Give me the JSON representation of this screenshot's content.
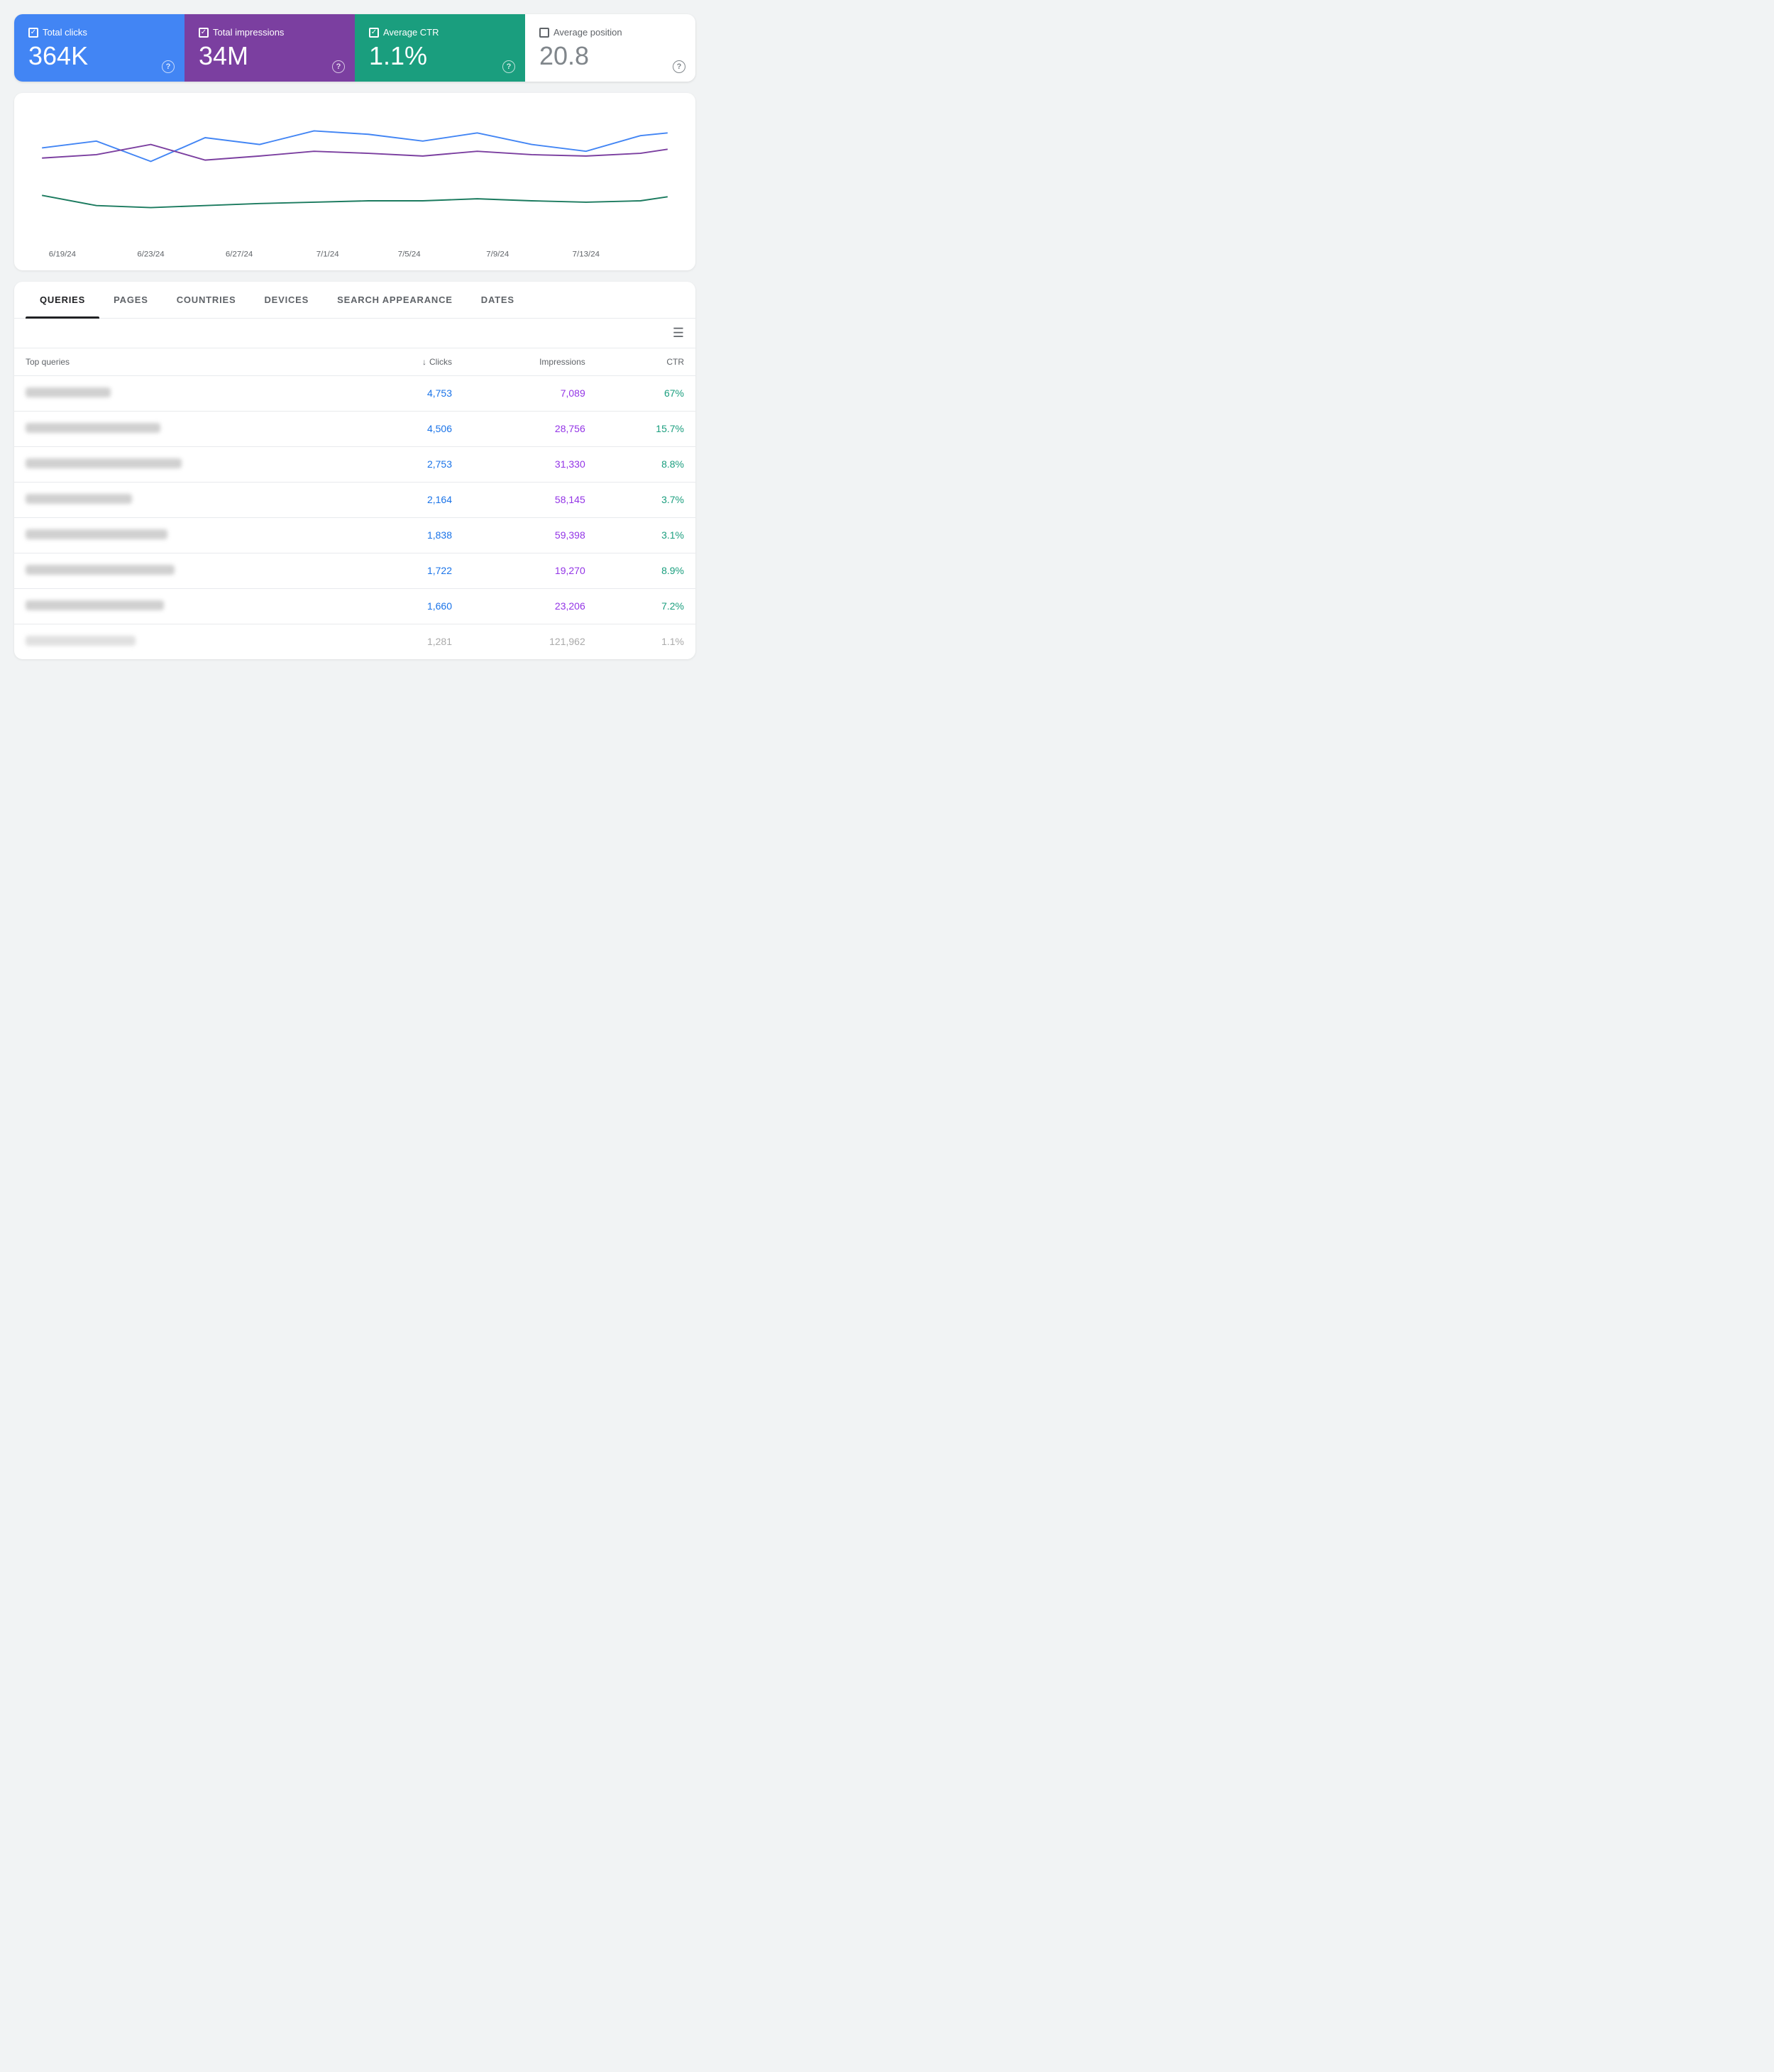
{
  "metrics": {
    "clicks": {
      "label": "Total clicks",
      "value": "364K",
      "checked": true,
      "help": "?"
    },
    "impressions": {
      "label": "Total impressions",
      "value": "34M",
      "checked": true,
      "help": "?"
    },
    "ctr": {
      "label": "Average CTR",
      "value": "1.1%",
      "checked": true,
      "help": "?"
    },
    "position": {
      "label": "Average position",
      "value": "20.8",
      "checked": false,
      "help": "?"
    }
  },
  "chart": {
    "dates": [
      "6/19/24",
      "6/23/24",
      "6/27/24",
      "7/1/24",
      "7/5/24",
      "7/9/24",
      "7/13/24"
    ]
  },
  "tabs": {
    "items": [
      {
        "label": "QUERIES",
        "active": true
      },
      {
        "label": "PAGES",
        "active": false
      },
      {
        "label": "COUNTRIES",
        "active": false
      },
      {
        "label": "DEVICES",
        "active": false
      },
      {
        "label": "SEARCH APPEARANCE",
        "active": false
      },
      {
        "label": "DATES",
        "active": false
      }
    ]
  },
  "table": {
    "header": {
      "query": "Top queries",
      "clicks": "Clicks",
      "impressions": "Impressions",
      "ctr": "CTR"
    },
    "rows": [
      {
        "query_width": 120,
        "clicks": "4,753",
        "impressions": "7,089",
        "ctr": "67%"
      },
      {
        "query_width": 190,
        "clicks": "4,506",
        "impressions": "28,756",
        "ctr": "15.7%"
      },
      {
        "query_width": 220,
        "clicks": "2,753",
        "impressions": "31,330",
        "ctr": "8.8%"
      },
      {
        "query_width": 150,
        "clicks": "2,164",
        "impressions": "58,145",
        "ctr": "3.7%"
      },
      {
        "query_width": 200,
        "clicks": "1,838",
        "impressions": "59,398",
        "ctr": "3.1%"
      },
      {
        "query_width": 210,
        "clicks": "1,722",
        "impressions": "19,270",
        "ctr": "8.9%"
      },
      {
        "query_width": 195,
        "clicks": "1,660",
        "impressions": "23,206",
        "ctr": "7.2%"
      },
      {
        "query_width": 155,
        "clicks": "1,281",
        "impressions": "121,962",
        "ctr": "1.1%",
        "last": true
      }
    ]
  }
}
